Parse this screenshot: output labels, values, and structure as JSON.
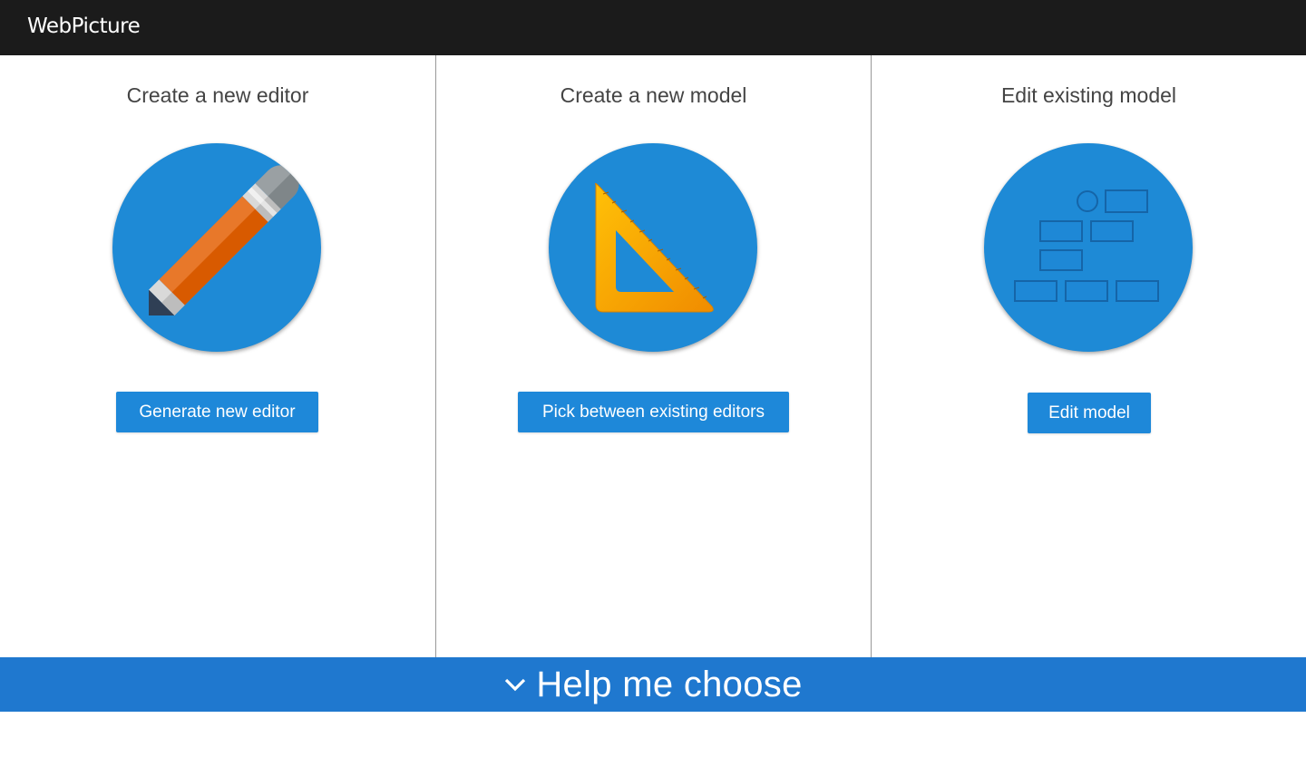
{
  "header": {
    "logo_pre": "Web",
    "logo_mid": "Pi",
    "logo_post": "cture",
    "background": "#1b1b1b"
  },
  "columns": [
    {
      "title": "Create a new editor",
      "icon": "pencil-icon",
      "button_label": "Generate new editor"
    },
    {
      "title": "Create a new model",
      "icon": "set-square-ruler-icon",
      "button_label": "Pick between existing editors"
    },
    {
      "title": "Edit existing model",
      "icon": "model-diagram-icon",
      "button_label": "Edit model"
    }
  ],
  "help": {
    "label": "Help me choose",
    "icon": "chevron-down-icon"
  },
  "colors": {
    "accent": "#1e88d9",
    "circle": "#1e8ad6",
    "help_bar": "#1f78cf"
  }
}
